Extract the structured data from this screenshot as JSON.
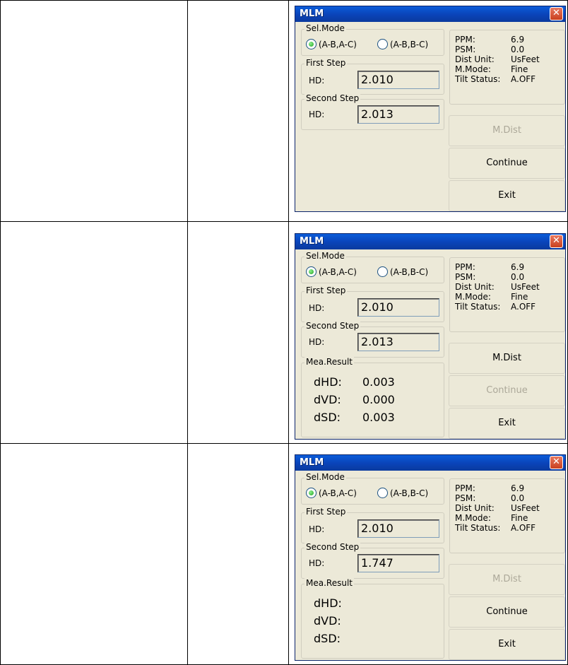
{
  "screens": [
    {
      "title": "MLM",
      "sel_mode_label": "Sel.Mode",
      "radio1": "(A-B,A-C)",
      "radio2": "(A-B,B-C)",
      "first_step_label": "First Step",
      "hd_label": "HD:",
      "first_hd": "2.010",
      "second_step_label": "Second Step",
      "second_hd": "2.013",
      "info": {
        "ppm_k": "PPM:",
        "ppm_v": "6.9",
        "psm_k": "PSM:",
        "psm_v": "0.0",
        "unit_k": "Dist Unit:",
        "unit_v": "UsFeet",
        "mode_k": "M.Mode:",
        "mode_v": "Fine",
        "tilt_k": "Tilt Status:",
        "tilt_v": "A.OFF"
      },
      "btn_mdist": "M.Dist",
      "btn_continue": "Continue",
      "btn_exit": "Exit"
    },
    {
      "title": "MLM",
      "sel_mode_label": "Sel.Mode",
      "radio1": "(A-B,A-C)",
      "radio2": "(A-B,B-C)",
      "first_step_label": "First Step",
      "hd_label": "HD:",
      "first_hd": "2.010",
      "second_step_label": "Second Step",
      "second_hd": "2.013",
      "info": {
        "ppm_k": "PPM:",
        "ppm_v": "6.9",
        "psm_k": "PSM:",
        "psm_v": "0.0",
        "unit_k": "Dist Unit:",
        "unit_v": "UsFeet",
        "mode_k": "M.Mode:",
        "mode_v": "Fine",
        "tilt_k": "Tilt Status:",
        "tilt_v": "A.OFF"
      },
      "result_label": "Mea.Result",
      "dhd_k": "dHD:",
      "dhd_v": "0.003",
      "dvd_k": "dVD:",
      "dvd_v": "0.000",
      "dsd_k": "dSD:",
      "dsd_v": "0.003",
      "btn_mdist": "M.Dist",
      "btn_continue": "Continue",
      "btn_exit": "Exit"
    },
    {
      "title": "MLM",
      "sel_mode_label": "Sel.Mode",
      "radio1": "(A-B,A-C)",
      "radio2": "(A-B,B-C)",
      "first_step_label": "First Step",
      "hd_label": "HD:",
      "first_hd": "2.010",
      "second_step_label": "Second Step",
      "second_hd": "1.747",
      "info": {
        "ppm_k": "PPM:",
        "ppm_v": "6.9",
        "psm_k": "PSM:",
        "psm_v": "0.0",
        "unit_k": "Dist Unit:",
        "unit_v": "UsFeet",
        "mode_k": "M.Mode:",
        "mode_v": "Fine",
        "tilt_k": "Tilt Status:",
        "tilt_v": "A.OFF"
      },
      "result_label": "Mea.Result",
      "dhd_k": "dHD:",
      "dvd_k": "dVD:",
      "dsd_k": "dSD:",
      "btn_mdist": "M.Dist",
      "btn_continue": "Continue",
      "btn_exit": "Exit"
    }
  ]
}
